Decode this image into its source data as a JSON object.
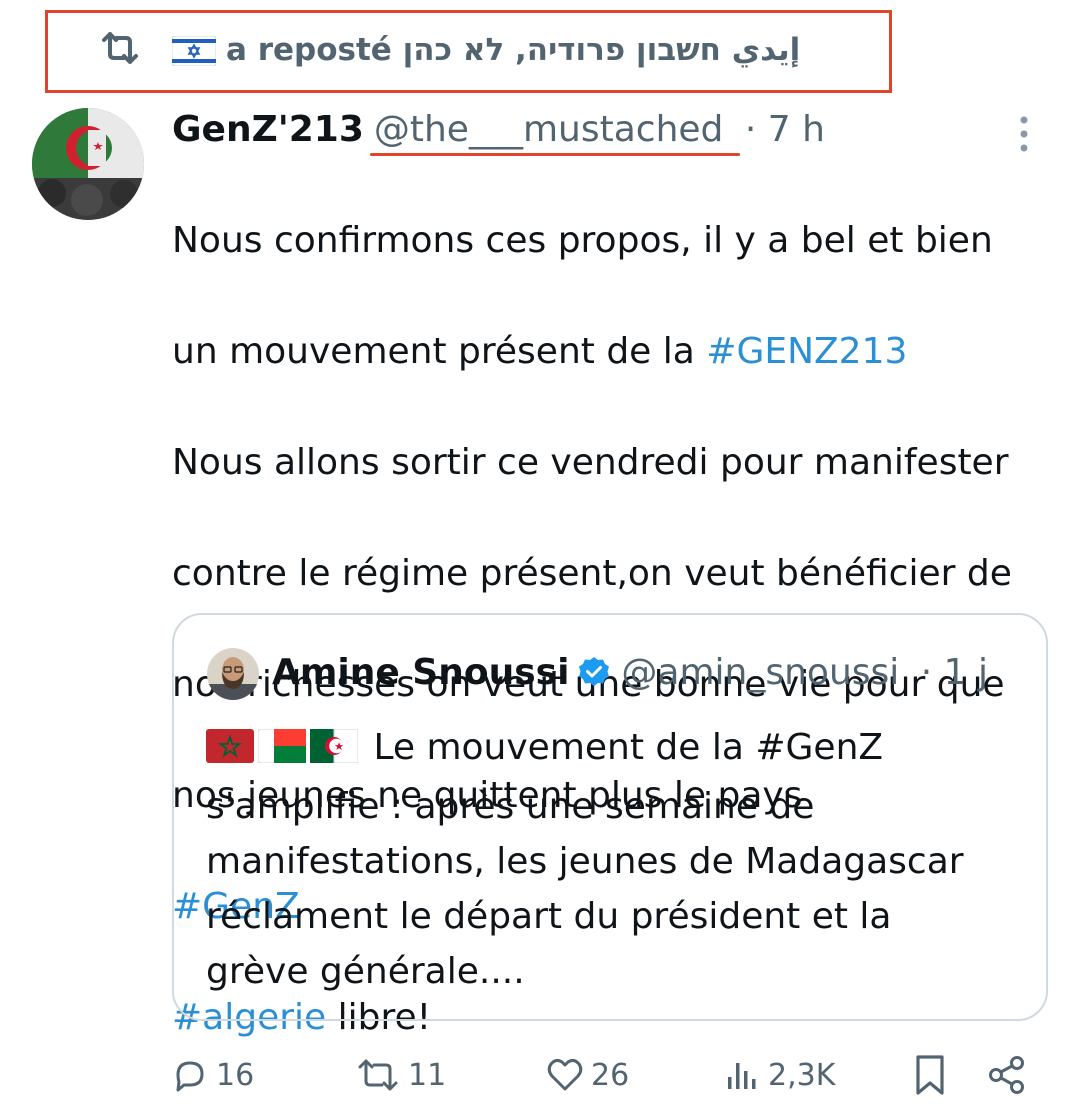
{
  "repost": {
    "icon": "repost-icon",
    "flag": "israel-flag",
    "text_fr": "a reposté",
    "name": "إيدي חשבון פרודיה, לא כהן"
  },
  "tweet": {
    "author_name": "GenZ'213",
    "author_handle": "@the___mustached",
    "time": "· 7 h",
    "more_icon": "more-vertical-icon",
    "lines": {
      "l1": "Nous confirmons ces propos, il y a bel et bien",
      "l2_text": "un mouvement présent de la ",
      "l2_tag": "#GENZ213",
      "l3": "Nous allons sortir ce vendredi pour manifester",
      "l4": "contre le régime présent,on veut bénéficier de",
      "l5": "nos richesses on veut une bonne vie pour que",
      "l6": "nos jeunes ne quittent plus le pays",
      "l7_tag": "#GenZ",
      "l8_tag": "#algerie",
      "l8_text": " libre!"
    }
  },
  "quote": {
    "author_name": "Amine Snoussi",
    "verified_icon": "verified-badge-icon",
    "author_handle": "@amin_snoussi",
    "time": "· 1 j",
    "flags": [
      "morocco-flag",
      "madagascar-flag",
      "algeria-flag"
    ],
    "lines": {
      "l1": " Le mouvement de la #GenZ",
      "l2": "s'amplifie : après une semaine de",
      "l3": "manifestations, les jeunes de Madagascar",
      "l4": "réclament le départ du président et la",
      "l5": "grève générale...."
    }
  },
  "actions": {
    "replies": "16",
    "reposts": "11",
    "likes": "26",
    "views": "2,3K"
  },
  "colors": {
    "accent_link": "#2a8fd5",
    "muted": "#536471",
    "highlight_red": "#e0442c",
    "verified_blue": "#1d9bf0"
  }
}
